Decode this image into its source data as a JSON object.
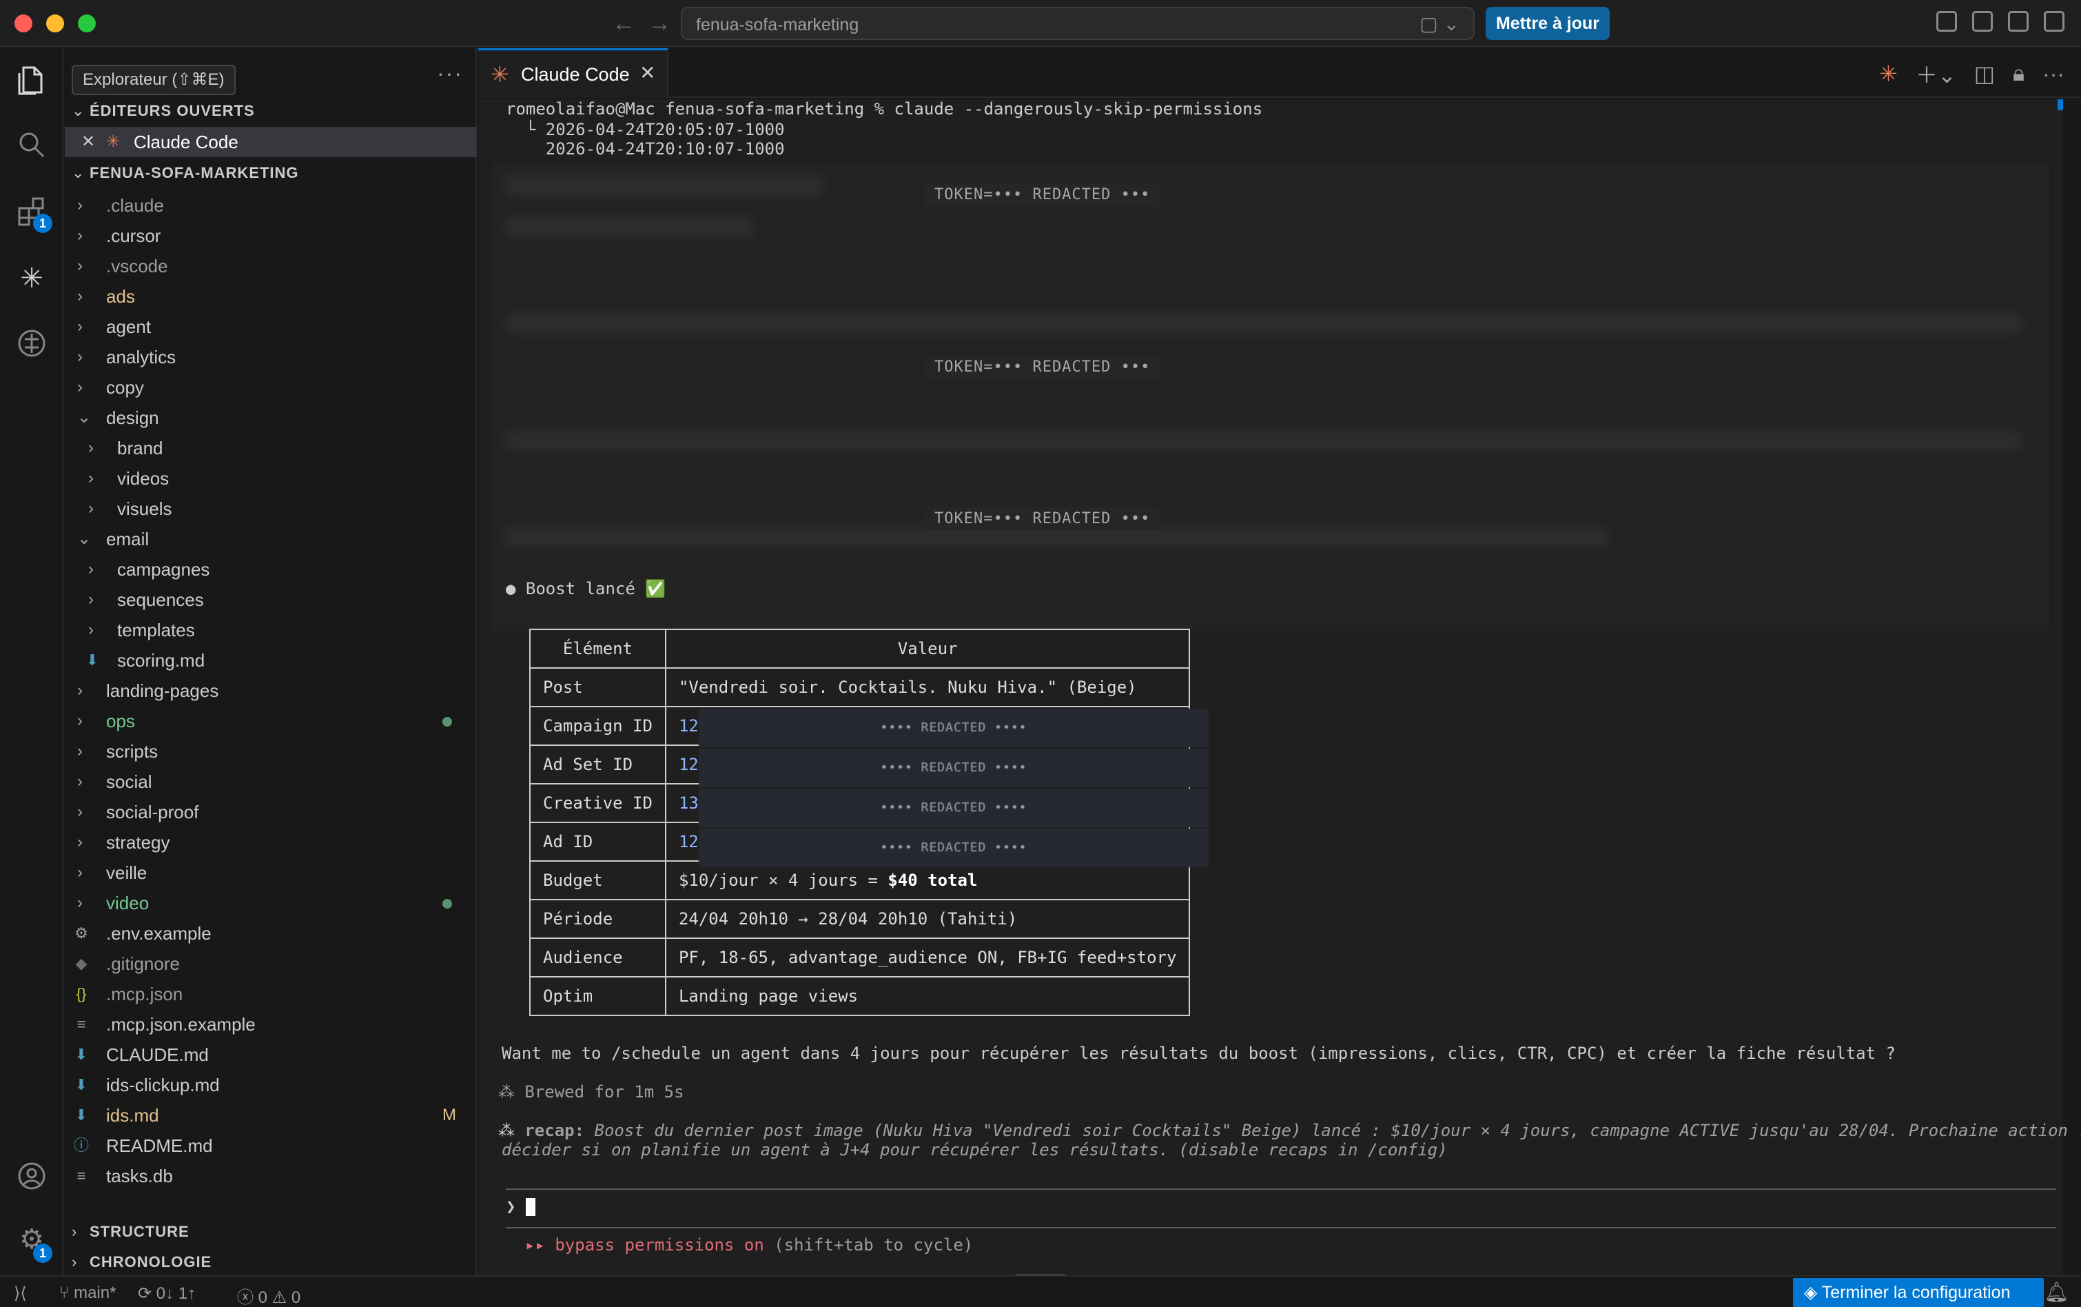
{
  "titlebar": {
    "search_title": "fenua-sofa-marketing",
    "update_button": "Mettre à jour"
  },
  "sidebar": {
    "tooltip": "Explorateur (⇧⌘E)",
    "open_editors_header": "ÉDITEURS OUVERTS",
    "open_editor_item": "Claude Code",
    "project_header": "FENUA-SOFA-MARKETING",
    "tree": [
      {
        "label": ".claude",
        "kind": "folder",
        "depth": 0,
        "color": "#9d9d9d"
      },
      {
        "label": ".cursor",
        "kind": "folder",
        "depth": 0,
        "color": "#cccccc"
      },
      {
        "label": ".vscode",
        "kind": "folder",
        "depth": 0,
        "color": "#9d9d9d"
      },
      {
        "label": "ads",
        "kind": "folder",
        "depth": 0,
        "color": "#e2c08d"
      },
      {
        "label": "agent",
        "kind": "folder",
        "depth": 0,
        "color": "#cccccc"
      },
      {
        "label": "analytics",
        "kind": "folder",
        "depth": 0,
        "color": "#cccccc"
      },
      {
        "label": "copy",
        "kind": "folder",
        "depth": 0,
        "color": "#cccccc"
      },
      {
        "label": "design",
        "kind": "folder-open",
        "depth": 0,
        "color": "#cccccc"
      },
      {
        "label": "brand",
        "kind": "folder",
        "depth": 1,
        "color": "#cccccc"
      },
      {
        "label": "videos",
        "kind": "folder",
        "depth": 1,
        "color": "#cccccc"
      },
      {
        "label": "visuels",
        "kind": "folder",
        "depth": 1,
        "color": "#cccccc"
      },
      {
        "label": "email",
        "kind": "folder-open",
        "depth": 0,
        "color": "#cccccc"
      },
      {
        "label": "campagnes",
        "kind": "folder",
        "depth": 1,
        "color": "#cccccc"
      },
      {
        "label": "sequences",
        "kind": "folder",
        "depth": 1,
        "color": "#cccccc"
      },
      {
        "label": "templates",
        "kind": "folder",
        "depth": 1,
        "color": "#cccccc"
      },
      {
        "label": "scoring.md",
        "kind": "md",
        "depth": 1,
        "color": "#cccccc"
      },
      {
        "label": "landing-pages",
        "kind": "folder",
        "depth": 0,
        "color": "#cccccc"
      },
      {
        "label": "ops",
        "kind": "folder",
        "depth": 0,
        "color": "#73c991",
        "dot": true
      },
      {
        "label": "scripts",
        "kind": "folder",
        "depth": 0,
        "color": "#cccccc"
      },
      {
        "label": "social",
        "kind": "folder",
        "depth": 0,
        "color": "#cccccc"
      },
      {
        "label": "social-proof",
        "kind": "folder",
        "depth": 0,
        "color": "#cccccc"
      },
      {
        "label": "strategy",
        "kind": "folder",
        "depth": 0,
        "color": "#cccccc"
      },
      {
        "label": "veille",
        "kind": "folder",
        "depth": 0,
        "color": "#cccccc"
      },
      {
        "label": "video",
        "kind": "folder",
        "depth": 0,
        "color": "#73c991",
        "dot": true
      },
      {
        "label": ".env.example",
        "kind": "gear",
        "depth": 0,
        "color": "#cccccc"
      },
      {
        "label": ".gitignore",
        "kind": "git",
        "depth": 0,
        "color": "#9d9d9d"
      },
      {
        "label": ".mcp.json",
        "kind": "json",
        "depth": 0,
        "color": "#9d9d9d"
      },
      {
        "label": ".mcp.json.example",
        "kind": "text",
        "depth": 0,
        "color": "#cccccc"
      },
      {
        "label": "CLAUDE.md",
        "kind": "md",
        "depth": 0,
        "color": "#cccccc"
      },
      {
        "label": "ids-clickup.md",
        "kind": "md",
        "depth": 0,
        "color": "#cccccc"
      },
      {
        "label": "ids.md",
        "kind": "md",
        "depth": 0,
        "color": "#e2c08d",
        "badge": "M"
      },
      {
        "label": "README.md",
        "kind": "info",
        "depth": 0,
        "color": "#cccccc"
      },
      {
        "label": "tasks.db",
        "kind": "text",
        "depth": 0,
        "color": "#cccccc"
      }
    ],
    "structure_header": "STRUCTURE",
    "timeline_header": "CHRONOLOGIE"
  },
  "activity": {
    "extensions_badge": "1",
    "settings_badge": "1"
  },
  "tab": {
    "label": "Claude Code"
  },
  "terminal": {
    "prompt_line": "romeolaifao@Mac fenua-sofa-marketing % claude --dangerously-skip-permissions",
    "log_line_1": "  └ 2026-04-24T20:05:07-1000",
    "log_line_2": "    2026-04-24T20:10:07-1000",
    "redacted_1": "TOKEN=••• REDACTED •••",
    "redacted_2": "TOKEN=••• REDACTED •••",
    "redacted_3": "TOKEN=••• REDACTED •••",
    "boost_status": "Boost lancé",
    "boost_check": "✅",
    "table": {
      "col_element": "Élément",
      "col_value": "Valeur",
      "rows": [
        {
          "key": "Post",
          "value": "\"Vendredi soir. Cocktails. Nuku Hiva.\" (Beige)"
        },
        {
          "key": "Campaign ID",
          "value": "12",
          "redacted": "•••• REDACTED ••••"
        },
        {
          "key": "Ad Set ID",
          "value": "12",
          "redacted": "•••• REDACTED ••••"
        },
        {
          "key": "Creative ID",
          "value": "13",
          "redacted": "•••• REDACTED ••••"
        },
        {
          "key": "Ad ID",
          "value": "12",
          "redacted": "•••• REDACTED ••••"
        },
        {
          "key": "Budget",
          "value": "$10/jour × 4 jours = ",
          "value_bold": "$40 total"
        },
        {
          "key": "Période",
          "value": "24/04 20h10 → 28/04 20h10 (Tahiti)"
        },
        {
          "key": "Audience",
          "value": "PF, 18-65, advantage_audience ON, FB+IG feed+story"
        },
        {
          "key": "Optim",
          "value": "Landing page views"
        }
      ]
    },
    "question": "Want me to /schedule un agent dans 4 jours pour récupérer les résultats du boost (impressions, clics, CTR, CPC) et créer la fiche résultat ?",
    "brewed": "Brewed for 1m 5s",
    "recap_label": "recap:",
    "recap_text_1": "Boost du dernier post image (Nuku Hiva \"Vendredi soir Cocktails\" Beige) lancé : $10/jour × 4 jours, campagne ACTIVE jusqu'au 28/04. Prochaine action :",
    "recap_text_2": "décider si on planifie un agent à J+4 pour récupérer les résultats. (disable recaps in /config)",
    "input_prompt": "❯",
    "bypass_arrows": "▸▸",
    "bypass_label": "bypass permissions on",
    "bypass_hint": "(shift+tab to cycle)"
  },
  "statusbar": {
    "branch": "main*",
    "sync": "0↓ 1↑",
    "errors": "0",
    "warnings": "0",
    "setup_button": "Terminer la configuration"
  }
}
